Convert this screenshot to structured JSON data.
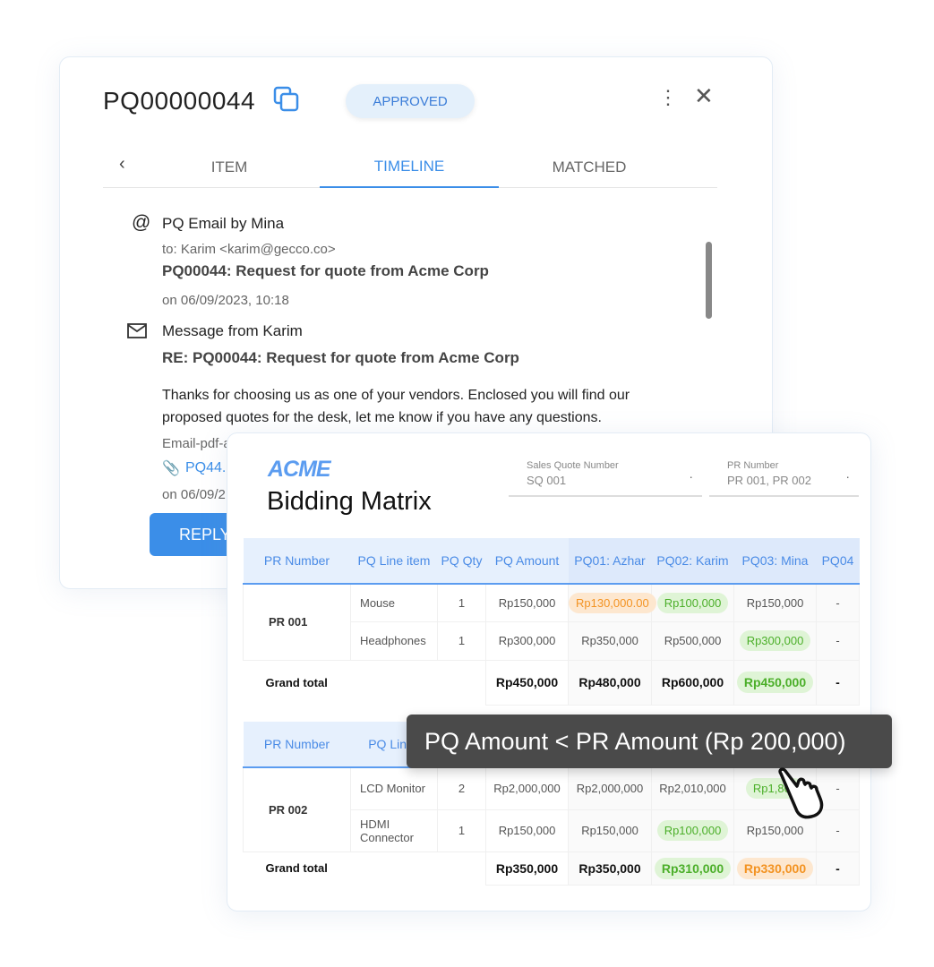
{
  "panel": {
    "title": "PQ00000044",
    "status": "APPROVED",
    "tabs": [
      "ITEM",
      "TIMELINE",
      "MATCHED"
    ],
    "active_tab": "TIMELINE",
    "timeline": [
      {
        "icon": "at-icon",
        "title": "PQ Email by Mina",
        "to": "to: Karim <karim@gecco.co>",
        "subject": "PQ00044: Request for quote from Acme Corp",
        "date": "on 06/09/2023, 10:18"
      },
      {
        "icon": "mail-icon",
        "title": "Message from Karim",
        "subject": "RE: PQ00044: Request for quote from Acme Corp",
        "body1": "Thanks for choosing us as one of your vendors. Enclosed you will find our",
        "body2": "proposed quotes for the desk, let me know if you have any questions.",
        "attachment_label": "Email-pdf-a",
        "attachment": "PQ44.",
        "date": "on 06/09/2"
      }
    ],
    "reply": "REPLY"
  },
  "matrix": {
    "logo": "ACME",
    "title": "Bidding Matrix",
    "sales_quote": {
      "label": "Sales Quote Number",
      "value": "SQ 001"
    },
    "pr_number": {
      "label": "PR Number",
      "value": "PR 001, PR 002"
    },
    "headers": [
      "PR Number",
      "PQ Line item",
      "PQ Qty",
      "PQ Amount",
      "PQ01: Azhar",
      "PQ02: Karim",
      "PQ03: Mina",
      "PQ04"
    ],
    "headers2": [
      "PR Number",
      "PQ Line i"
    ],
    "groups": [
      {
        "pr": "PR 001",
        "rows": [
          {
            "item": "Mouse",
            "qty": "1",
            "amount": "Rp150,000",
            "pq": [
              {
                "v": "Rp130,000.00",
                "s": "o"
              },
              {
                "v": "Rp100,000",
                "s": "g"
              },
              {
                "v": "Rp150,000",
                "s": ""
              },
              {
                "v": "-",
                "s": ""
              }
            ]
          },
          {
            "item": "Headphones",
            "qty": "1",
            "amount": "Rp300,000",
            "pq": [
              {
                "v": "Rp350,000",
                "s": ""
              },
              {
                "v": "Rp500,000",
                "s": ""
              },
              {
                "v": "Rp300,000",
                "s": "g"
              },
              {
                "v": "-",
                "s": ""
              }
            ]
          }
        ],
        "total": {
          "label": "Grand total",
          "amount": "Rp450,000",
          "pq": [
            {
              "v": "Rp480,000",
              "s": ""
            },
            {
              "v": "Rp600,000",
              "s": ""
            },
            {
              "v": "Rp450,000",
              "s": "g"
            },
            {
              "v": "-",
              "s": ""
            }
          ]
        }
      },
      {
        "pr": "PR 002",
        "rows": [
          {
            "item": "LCD Monitor",
            "qty": "2",
            "amount": "Rp2,000,000",
            "pq": [
              {
                "v": "Rp2,000,000",
                "s": ""
              },
              {
                "v": "Rp2,010,000",
                "s": ""
              },
              {
                "v": "Rp1,800",
                "s": "g"
              },
              {
                "v": "-",
                "s": ""
              }
            ]
          },
          {
            "item": "HDMI Connector",
            "qty": "1",
            "amount": "Rp150,000",
            "pq": [
              {
                "v": "Rp150,000",
                "s": ""
              },
              {
                "v": "Rp100,000",
                "s": "g"
              },
              {
                "v": "Rp150,000",
                "s": ""
              },
              {
                "v": "-",
                "s": ""
              }
            ]
          }
        ],
        "total": {
          "label": "Grand total",
          "amount": "Rp350,000",
          "pq": [
            {
              "v": "Rp350,000",
              "s": ""
            },
            {
              "v": "Rp310,000",
              "s": "g"
            },
            {
              "v": "Rp330,000",
              "s": "o"
            },
            {
              "v": "-",
              "s": ""
            }
          ]
        }
      }
    ]
  },
  "tooltip": "PQ Amount < PR Amount (Rp 200,000)",
  "colors": {
    "accent": "#3b8ee8",
    "green": "#4caf2a",
    "orange": "#f39322"
  }
}
